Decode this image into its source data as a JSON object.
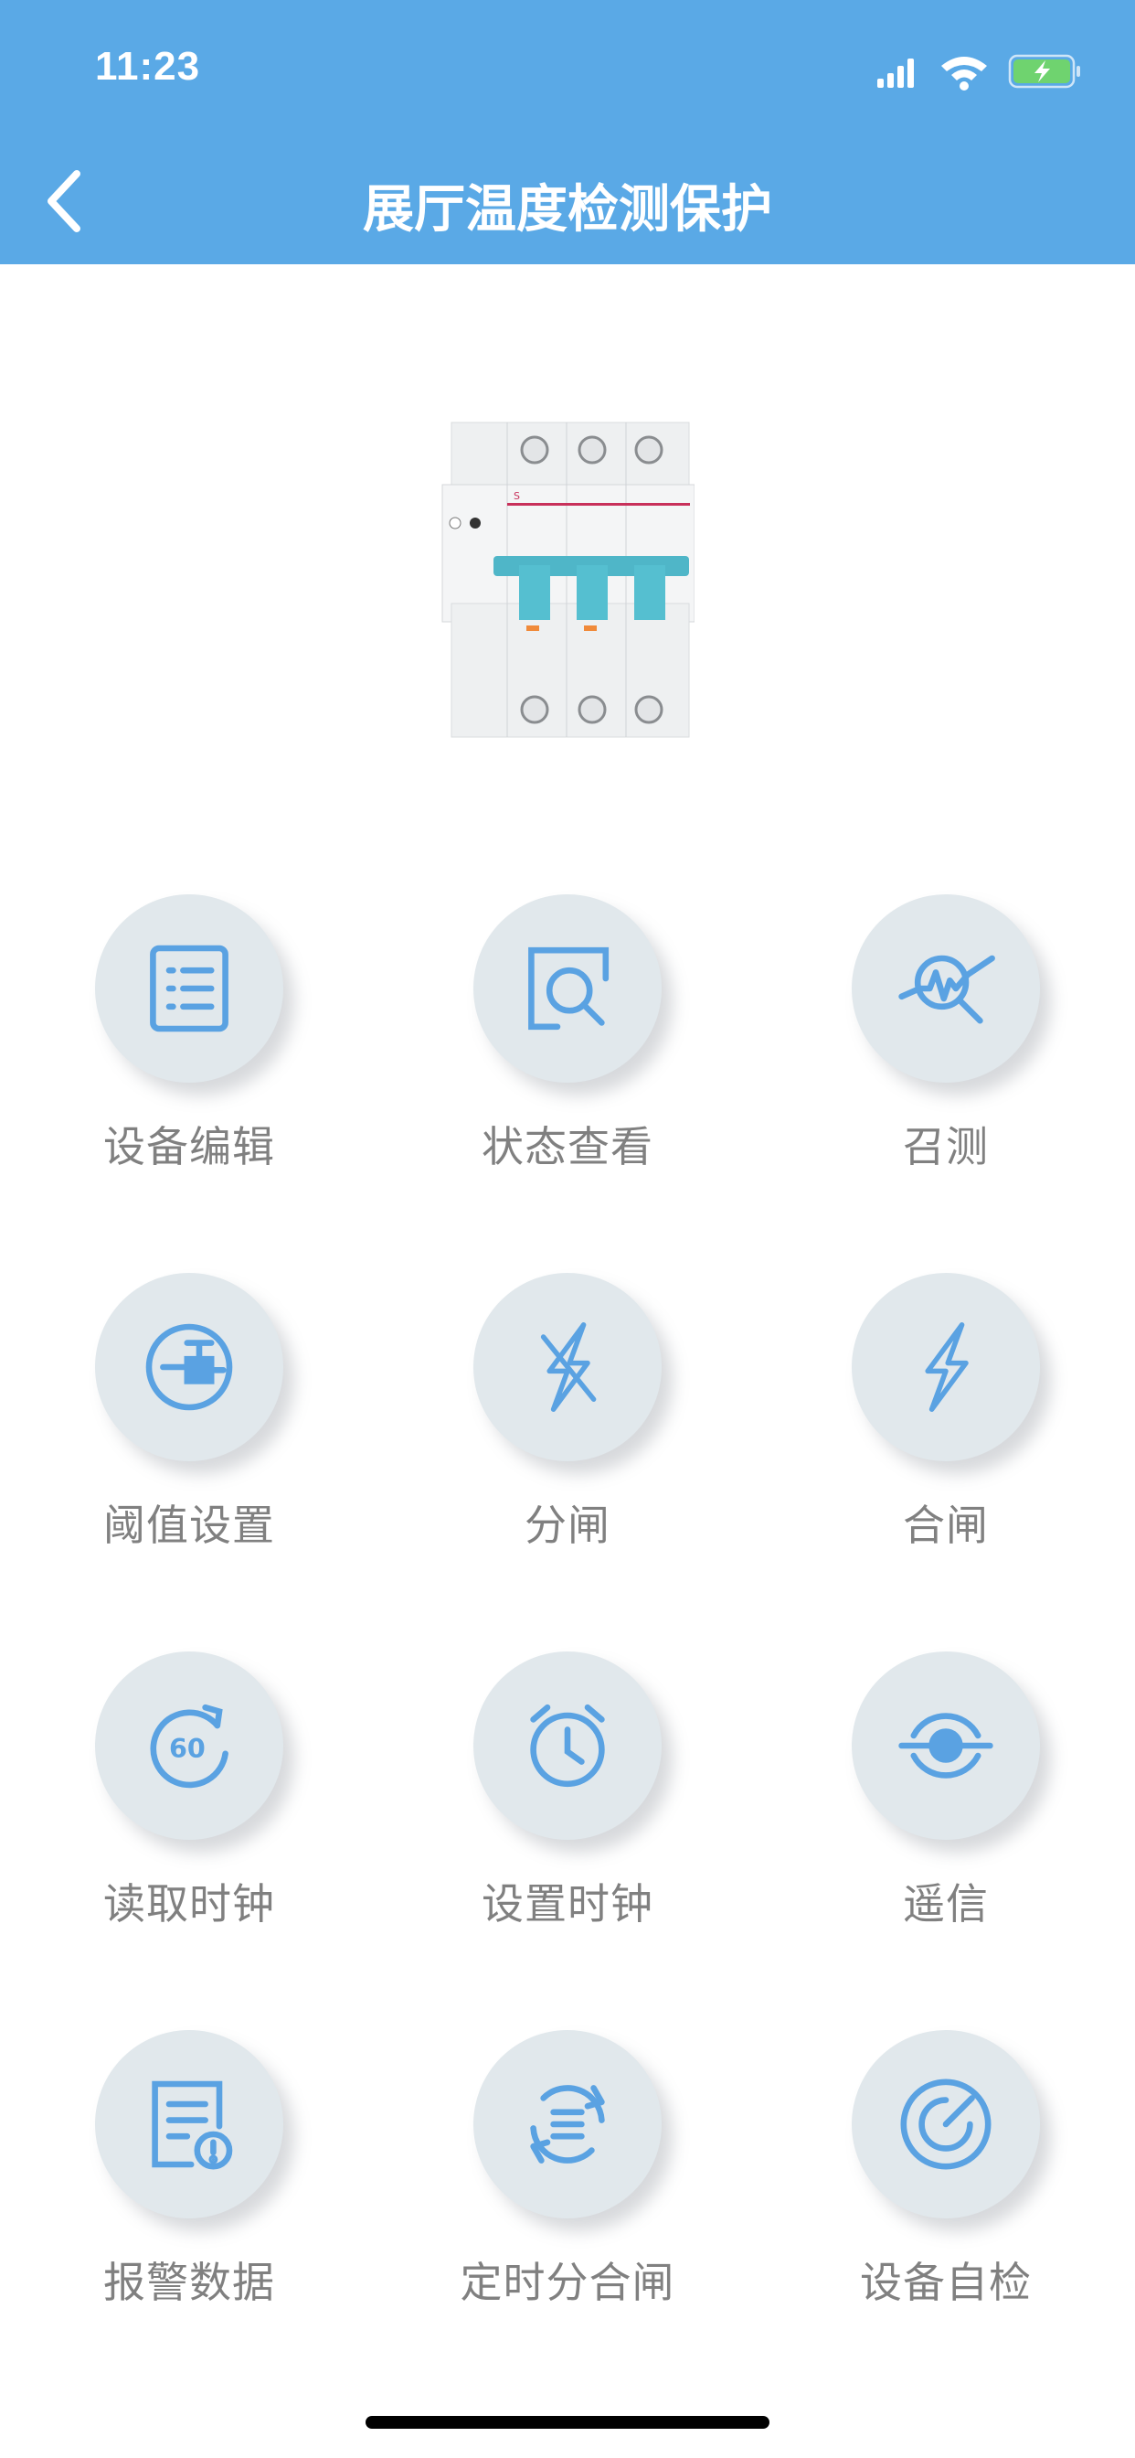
{
  "status_bar": {
    "time": "11:23"
  },
  "header": {
    "title": "展厅温度检测保护"
  },
  "functions": [
    {
      "label": "设备编辑",
      "icon": "list-icon"
    },
    {
      "label": "状态查看",
      "icon": "magnifier-icon"
    },
    {
      "label": "召测",
      "icon": "pulse-search-icon"
    },
    {
      "label": "阈值设置",
      "icon": "valve-icon"
    },
    {
      "label": "分闸",
      "icon": "lightning-off-icon"
    },
    {
      "label": "合闸",
      "icon": "lightning-icon"
    },
    {
      "label": "读取时钟",
      "icon": "timer-60-icon"
    },
    {
      "label": "设置时钟",
      "icon": "alarm-clock-icon"
    },
    {
      "label": "遥信",
      "icon": "eye-signal-icon"
    },
    {
      "label": "报警数据",
      "icon": "alert-document-icon"
    },
    {
      "label": "定时分合闸",
      "icon": "cycle-list-icon"
    },
    {
      "label": "设备自检",
      "icon": "gauge-icon"
    }
  ],
  "colors": {
    "header": "#5aa9e6",
    "icon": "#5aa2e2",
    "circle": "#e1e8ec",
    "label": "#808080"
  }
}
